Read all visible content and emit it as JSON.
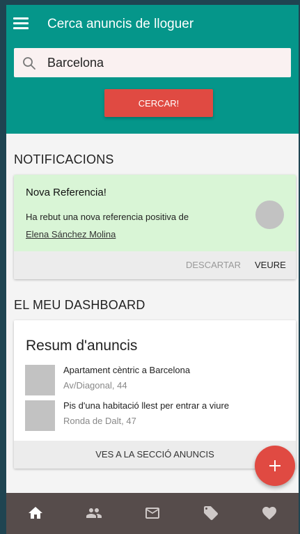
{
  "header": {
    "title": "Cerca anuncis de lloguer",
    "menu_icon": "menu-icon",
    "search": {
      "value": "Barcelona",
      "icon": "search-icon"
    },
    "search_button_label": "CERCAR!"
  },
  "notifications": {
    "section_title": "NOTIFICACIONS",
    "card": {
      "title": "Nova Referencia!",
      "text": "Ha rebut una nova referencia positiva de",
      "link": "Elena Sánchez Molina",
      "dismiss_label": "DESCARTAR",
      "view_label": "VEURE"
    }
  },
  "dashboard": {
    "section_title": "EL MEU DASHBOARD",
    "card": {
      "title": "Resum d'anuncis",
      "listings": [
        {
          "title": "Apartament cèntric a Barcelona",
          "address": "Av/Diagonal, 44"
        },
        {
          "title": "Pis d'una habitació llest per entrar a viure",
          "address": "Ronda de Dalt, 47"
        }
      ],
      "action_label": "VES A LA SECCIÓ ANUNCIS"
    }
  },
  "fab_icon": "plus-icon",
  "bottom_nav": [
    {
      "icon": "home-icon",
      "active": true
    },
    {
      "icon": "people-icon",
      "active": false
    },
    {
      "icon": "mail-icon",
      "active": false
    },
    {
      "icon": "tag-icon",
      "active": false
    },
    {
      "icon": "heart-icon",
      "active": false
    }
  ],
  "colors": {
    "primary": "#05968a",
    "accent": "#e04a42",
    "notification_bg": "#d9f5d6",
    "nav_bg": "#564c4b",
    "outer_bg": "#1f4451"
  }
}
